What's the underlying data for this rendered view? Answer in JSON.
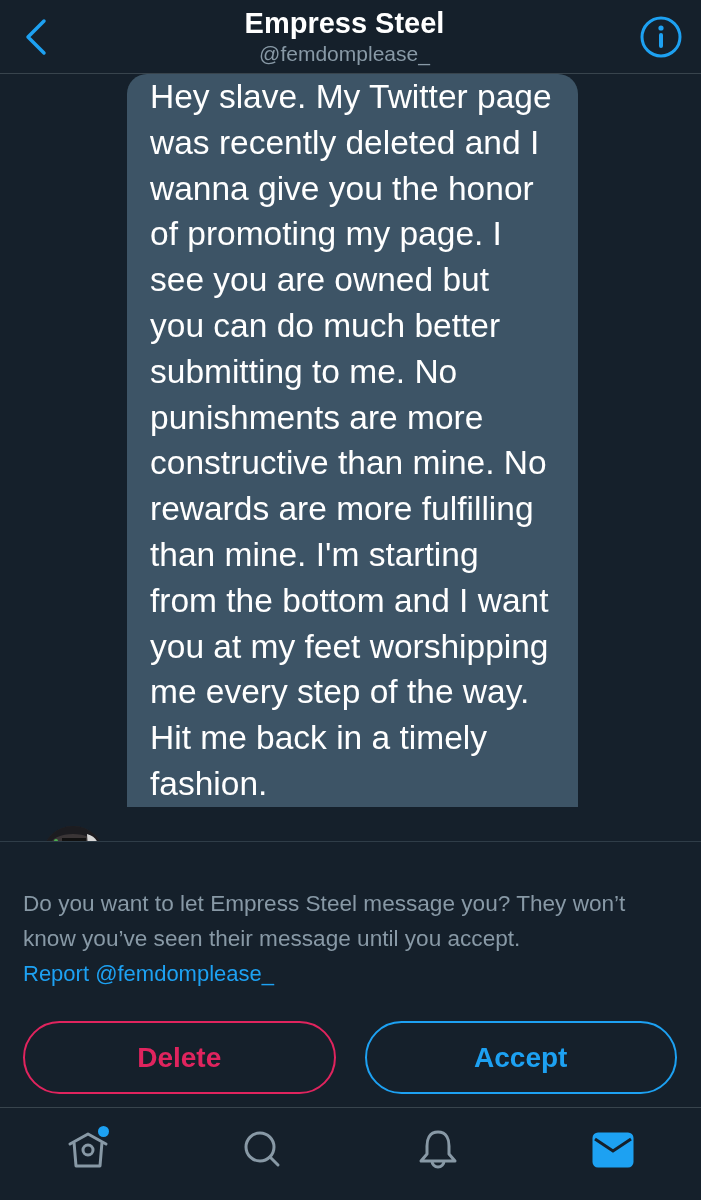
{
  "header": {
    "title": "Empress Steel",
    "handle": "@femdomplease_"
  },
  "message": {
    "text": "Hey slave. My Twitter page was recently deleted and I wanna give you the honor of promoting my page. I see you are owned but you can do much better submitting to me. No punishments are more constructive than mine. No rewards are more fulfilling than mine. I'm starting from the bottom and I want you at my feet worshipping me every step of the way. Hit me back in a timely fashion."
  },
  "request": {
    "prompt": "Do you want to let Empress Steel message you? They won’t know you’ve seen their message until you accept.",
    "report_link": "Report @femdomplease_"
  },
  "buttons": [
    {
      "label": "Delete",
      "kind": "delete"
    },
    {
      "label": "Accept",
      "kind": "accept"
    }
  ],
  "tabs": [
    {
      "kind": "home",
      "selected": false,
      "badge": true
    },
    {
      "kind": "search",
      "selected": false,
      "badge": false
    },
    {
      "kind": "notifications",
      "selected": false,
      "badge": false
    },
    {
      "kind": "messages",
      "selected": true,
      "badge": false
    }
  ]
}
